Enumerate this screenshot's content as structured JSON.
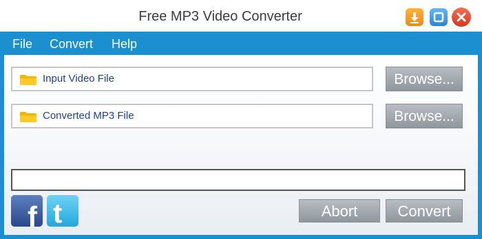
{
  "window": {
    "title": "Free MP3 Video Converter"
  },
  "titlebar_buttons": [
    {
      "name": "download-icon",
      "color": "#f5a021"
    },
    {
      "name": "maximize-icon",
      "color": "#3a92de"
    },
    {
      "name": "close-icon",
      "color": "#e6472c"
    }
  ],
  "menu": {
    "items": [
      "File",
      "Convert",
      "Help"
    ]
  },
  "input_video": {
    "label": "Input Video File",
    "browse_label": "Browse..."
  },
  "output_mp3": {
    "label": "Converted MP3 File",
    "browse_label": "Browse..."
  },
  "progress": {
    "value": 0
  },
  "social": [
    {
      "name": "facebook-icon",
      "glyph": "f"
    },
    {
      "name": "twitter-icon",
      "glyph": "t"
    }
  ],
  "actions": {
    "abort_label": "Abort",
    "convert_label": "Convert"
  },
  "colors": {
    "accent": "#1b8fd0",
    "button": "#9aa1a7",
    "field_text": "#1c3f9c"
  }
}
